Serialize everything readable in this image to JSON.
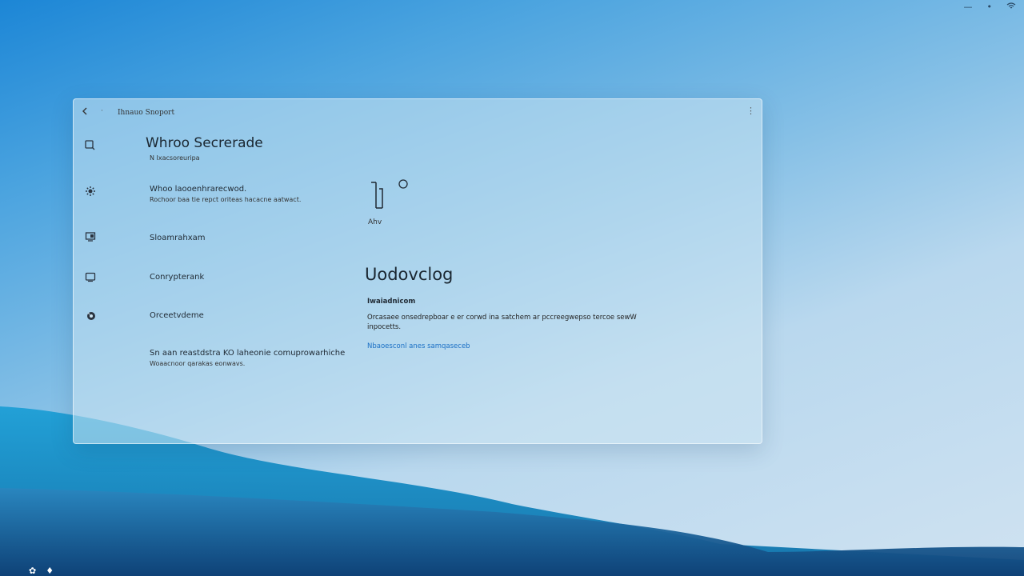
{
  "window": {
    "title": "Ihnauo Snoport",
    "header": {
      "title": "Whroo Secrerade",
      "subtitle": "N Ixacsoreuripa"
    },
    "nav_items": [
      {
        "label": "Whoo laooenhrarecwod.",
        "sublabel": "Rochoor baa tie repct oriteas hacacne aatwact.",
        "icon": "gear-icon"
      },
      {
        "label": "Sloamrahxam",
        "sublabel": "",
        "icon": "monitor-icon"
      },
      {
        "label": "Conrypterank",
        "sublabel": "",
        "icon": "window-icon"
      },
      {
        "label": "Orceetvdeme",
        "sublabel": "",
        "icon": "settings-icon"
      },
      {
        "label": "Sn aan reastdstra KO laheonie comuprowarhiche",
        "sublabel": "Woaacnoor qarakas eonwavs.",
        "icon": ""
      }
    ],
    "status": {
      "label": "Ahv"
    },
    "section": {
      "title": "Uodovclog",
      "heading": "Iwaiadnicom",
      "body": "Orcasaee onsedrepboar e er corwd ina satchem ar pccreegwepso tercoe sewW inpocetts.",
      "link": "Nbaoesconl anes samqaseceb"
    }
  },
  "icons": {
    "back": "back-arrow-icon",
    "titlebar_dot": "dot-icon",
    "window_control": "more-icon",
    "header": "search-icon",
    "status_glyph": "device-icon",
    "tray_minimize": "minimize-icon",
    "tray_more": "more-icon",
    "tray_wifi": "wifi-icon"
  },
  "colors": {
    "link": "#1a6fc4",
    "window_bg": "rgba(205,230,242,0.55)"
  }
}
